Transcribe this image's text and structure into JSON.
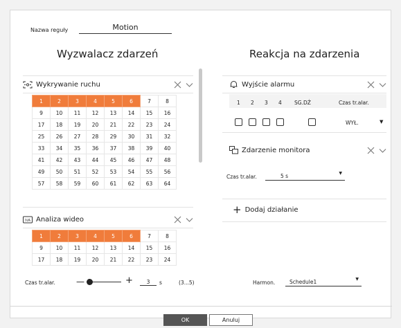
{
  "rule": {
    "label": "Nazwa reguły",
    "value": "Motion"
  },
  "trigger": {
    "title": "Wyzwalacz zdarzeń",
    "motion": {
      "label": "Wykrywanie ruchu",
      "rows": [
        [
          "1",
          "2",
          "3",
          "4",
          "5",
          "6",
          "7",
          "8"
        ],
        [
          "9",
          "10",
          "11",
          "12",
          "13",
          "14",
          "15",
          "16"
        ],
        [
          "17",
          "18",
          "19",
          "20",
          "21",
          "22",
          "23",
          "24"
        ],
        [
          "25",
          "26",
          "27",
          "28",
          "29",
          "30",
          "31",
          "32"
        ],
        [
          "33",
          "34",
          "35",
          "36",
          "37",
          "38",
          "39",
          "40"
        ],
        [
          "41",
          "42",
          "43",
          "44",
          "45",
          "46",
          "47",
          "48"
        ],
        [
          "49",
          "50",
          "51",
          "52",
          "53",
          "54",
          "55",
          "56"
        ],
        [
          "57",
          "58",
          "59",
          "60",
          "61",
          "62",
          "63",
          "64"
        ]
      ],
      "selected": [
        "1",
        "2",
        "3",
        "4",
        "5",
        "6"
      ]
    },
    "video": {
      "label": "Analiza wideo",
      "rows": [
        [
          "1",
          "2",
          "3",
          "4",
          "5",
          "6",
          "7",
          "8"
        ],
        [
          "9",
          "10",
          "11",
          "12",
          "13",
          "14",
          "15",
          "16"
        ],
        [
          "17",
          "18",
          "19",
          "20",
          "21",
          "22",
          "23",
          "24"
        ]
      ],
      "selected": [
        "1",
        "2",
        "3",
        "4",
        "5",
        "6"
      ]
    },
    "alarm_time": {
      "label": "Czas tr.alar.",
      "value": "3",
      "unit": "s",
      "range": "(3...5)",
      "level": 0.0
    }
  },
  "reaction": {
    "title": "Reakcja na zdarzenia",
    "alarm_out": {
      "label": "Wyjście alarmu",
      "columns": [
        "1",
        "2",
        "3",
        "4",
        "SG.DŹ",
        "Czas tr.alar."
      ],
      "duration_value": "WYŁ."
    },
    "monitor_event": {
      "label": "Zdarzenie monitora",
      "time_label": "Czas tr.alar.",
      "time_value": "5 s"
    },
    "add_action": "Dodaj działanie",
    "schedule": {
      "label": "Harmon.",
      "value": "Schedule1"
    }
  },
  "buttons": {
    "ok": "OK",
    "cancel": "Anuluj"
  },
  "colors": {
    "accent": "#f07c3b"
  }
}
